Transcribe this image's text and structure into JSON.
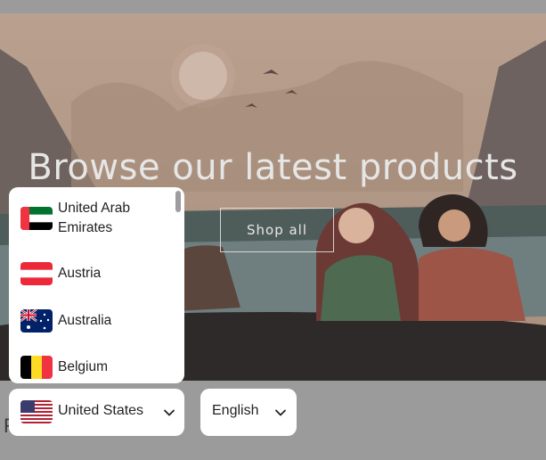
{
  "hero": {
    "title": "Browse our latest products",
    "button_label": "Shop all"
  },
  "below": {
    "text": "F"
  },
  "country_dropdown": {
    "items": [
      {
        "label": "United Arab\nEmirates",
        "flag": "uae-flag-icon"
      },
      {
        "label": "Austria",
        "flag": "austria-flag-icon"
      },
      {
        "label": "Australia",
        "flag": "australia-flag-icon"
      },
      {
        "label": "Belgium",
        "flag": "belgium-flag-icon"
      }
    ]
  },
  "country_select": {
    "value": "United States",
    "flag": "us-flag-icon",
    "icon": "chevron-down-icon"
  },
  "language_select": {
    "value": "English",
    "icon": "chevron-down-icon"
  }
}
